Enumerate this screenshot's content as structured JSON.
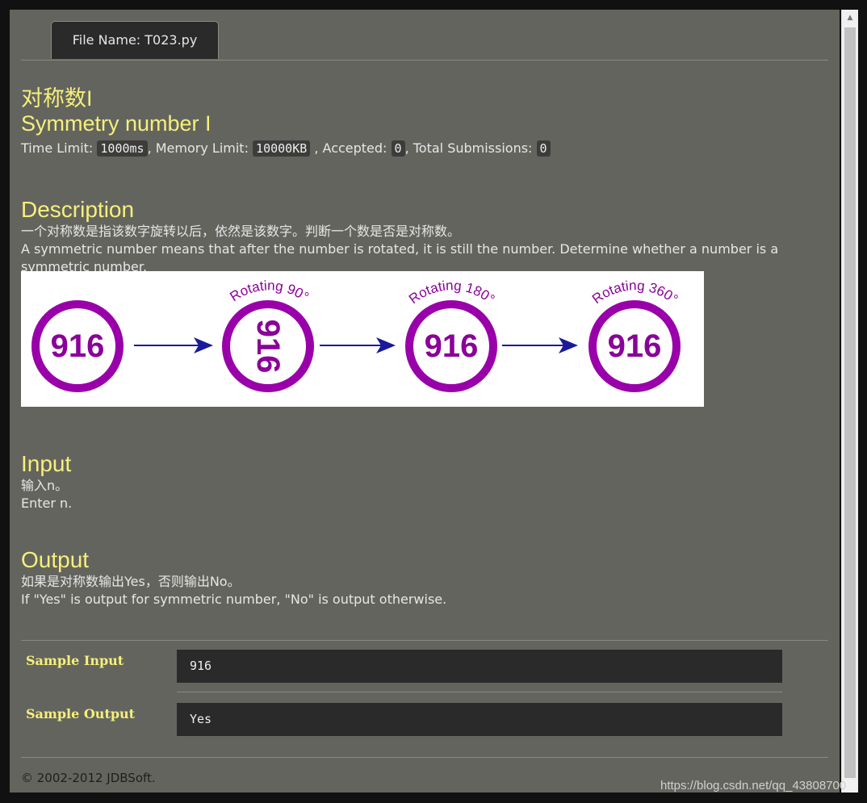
{
  "tab": {
    "label": "File Name:  T023.py"
  },
  "problem": {
    "title_cn": "对称数I",
    "title_en": "Symmetry number I",
    "limits": {
      "time_label": "Time Limit: ",
      "time_value": "1000ms",
      "memory_label": ", Memory Limit: ",
      "memory_value": "10000KB",
      "accepted_label": " , Accepted: ",
      "accepted_value": "0",
      "total_label": ", Total Submissions: ",
      "total_value": "0"
    }
  },
  "description": {
    "heading": "Description",
    "text_cn": "一个对称数是指该数字旋转以后，依然是该数字。判断一个数是否是对称数。",
    "text_en": "A symmetric number means that after the number is rotated, it is still the number. Determine whether a number is a symmetric number.",
    "figure": {
      "number": "916",
      "labels": [
        "Rotating 90°",
        "Rotating 180°",
        "Rotating 360°"
      ]
    }
  },
  "input": {
    "heading": "Input",
    "text_cn": "输入n。",
    "text_en": "Enter n."
  },
  "output": {
    "heading": "Output",
    "text_cn": "如果是对称数输出Yes，否则输出No。",
    "text_en": "If \"Yes\" is output for symmetric number, \"No\" is output otherwise."
  },
  "samples": {
    "input_label": "Sample Input",
    "input_value": "916",
    "output_label": "Sample Output",
    "output_value": "Yes"
  },
  "footer": {
    "copyright": "© 2002-2012  JDBSoft."
  },
  "watermark": "https://blog.csdn.net/qq_43808700",
  "colors": {
    "background": "#64645f",
    "heading": "#f5f07a",
    "figure_ring": "#9900aa",
    "arrow": "#1a1a9a"
  }
}
